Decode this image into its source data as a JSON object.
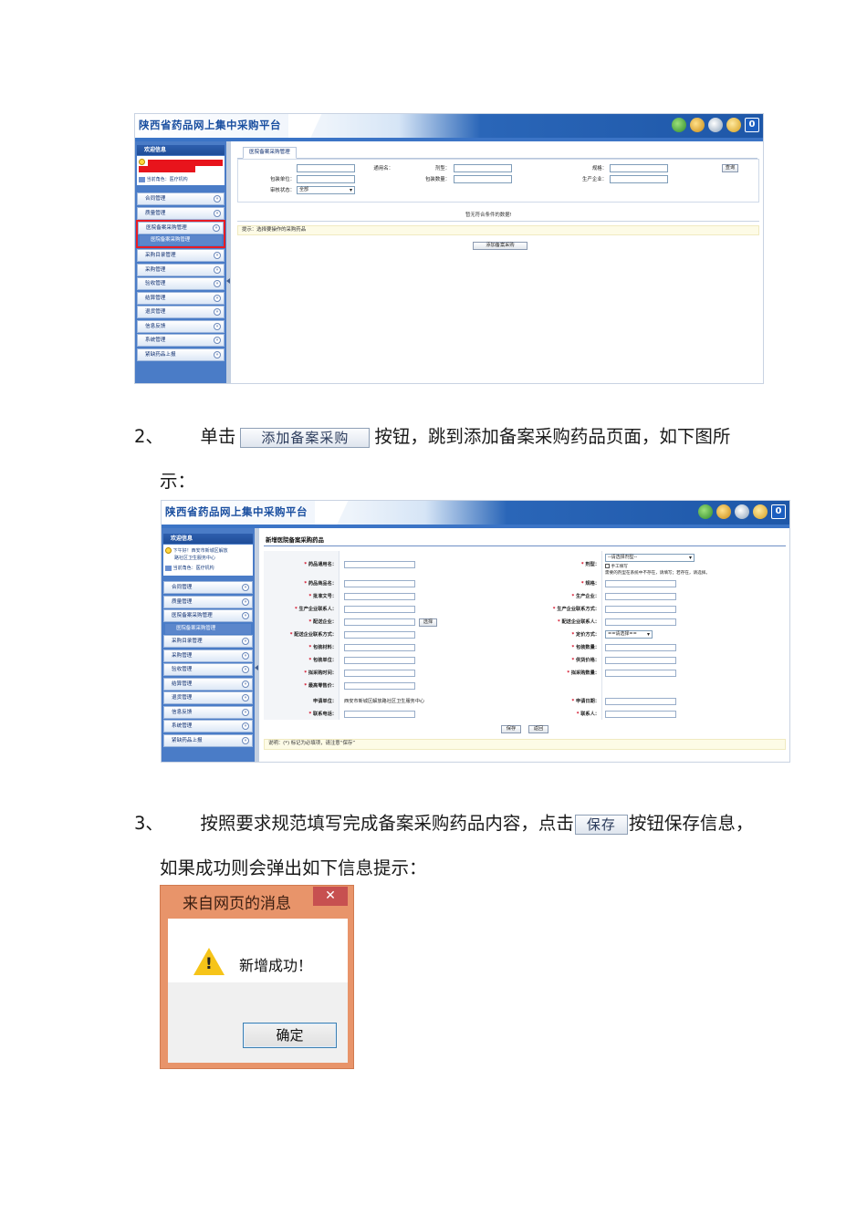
{
  "platform": {
    "title": "陕西省药品网上集中采购平台",
    "logout_icon_text": "0"
  },
  "shot1": {
    "sidebar": {
      "header": "欢迎信息",
      "role": "当前角色：医疗机构",
      "menu": [
        "合同管理",
        "质量管理",
        "医院备案采购管理",
        "采购目录管理",
        "采购管理",
        "验收管理",
        "结算管理",
        "退货管理",
        "信息反馈",
        "系统管理",
        "紧缺药品上报"
      ],
      "submenu": "医院备案采购管理"
    },
    "tab": "医院备案采购管理",
    "query": {
      "generic_name": "通用名：",
      "dosage_form": "剂型：",
      "spec": "规格：",
      "pack_unit": "包装单位：",
      "pack_qty": "包装数量：",
      "manufacturer": "生产企业：",
      "review_status": "审核状态：",
      "review_value": "全部",
      "search_btn": "查询"
    },
    "empty_msg": "暂无符合条件的数据!",
    "tip": "提示：选择要操作的采购药品",
    "add_btn": "添加备案采购"
  },
  "step2": {
    "num": "2、",
    "pre": "单击",
    "btn": "添加备案采购",
    "post": "按钮，跳到添加备案采购药品页面，如下图所",
    "cont": "示："
  },
  "shot2": {
    "sidebar": {
      "header": "欢迎信息",
      "greet1": "下午好！西安市新城区解放",
      "greet2": "路社区卫生服务中心",
      "role": "当前角色：医疗机构",
      "menu": [
        "合同管理",
        "质量管理",
        "医院备案采购管理",
        "采购目录管理",
        "采购管理",
        "验收管理",
        "结算管理",
        "退货管理",
        "信息反馈",
        "系统管理",
        "紧缺药品上报"
      ],
      "submenu": "医院备案采购管理"
    },
    "form_title": "新增医院备案采购药品",
    "left_labels": [
      "药品通用名：",
      "药品商品名：",
      "批准文号：",
      "生产企业联系人：",
      "配送企业：",
      "配送企业联系方式：",
      "包装材料：",
      "包装单位：",
      "拟采购时间：",
      "最高零售价：",
      "申请单位：",
      "联系电话："
    ],
    "right_labels": [
      "剂型：",
      "规格：",
      "生产企业：",
      "生产企业联系方式：",
      "配送企业联系人：",
      "定价方式：",
      "包装数量：",
      "供货价格：",
      "拟采购数量：",
      "申请日期：",
      "联系人："
    ],
    "dosage_select": "--请选择剂型--",
    "manual_label": "手工填写",
    "dosage_hint": "需要的剂型在系统中不存在，请填写；若存在，请选择。",
    "pricing_select": "==请选择==",
    "choose_btn": "选择",
    "applicant_value": "西安市新城区解放路社区卫生服务中心",
    "save_btn": "保存",
    "back_btn": "返回",
    "note": "说明：(*) 标记为必填项，请注意“保存”"
  },
  "step3": {
    "num": "3、",
    "pre": "按照要求规范填写完成备案采购药品内容，点击",
    "btn": "保存",
    "post": "按钮保存信息，",
    "cont": "如果成功则会弹出如下信息提示："
  },
  "dialog": {
    "title": "来自网页的消息",
    "close": "✕",
    "message": "新增成功！",
    "ok": "确定"
  }
}
